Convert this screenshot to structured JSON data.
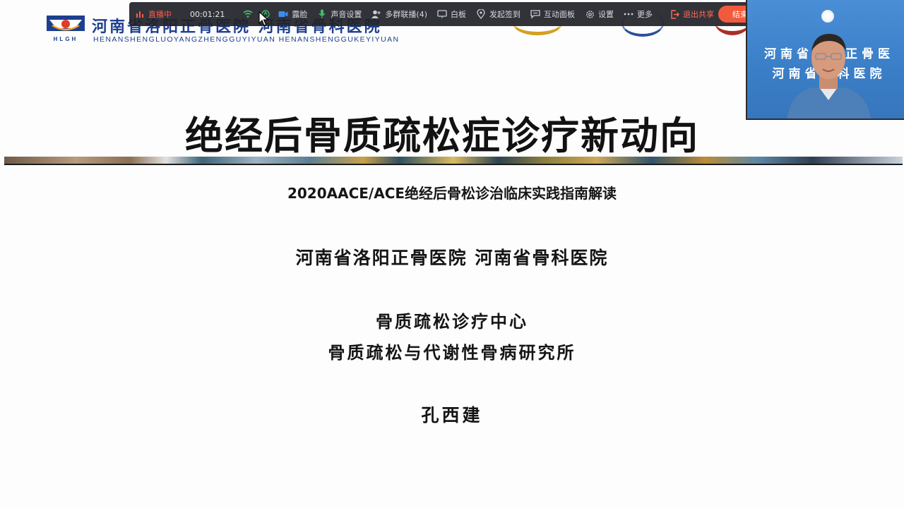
{
  "slide": {
    "logo": {
      "brand_letters": "HLGH",
      "name_cn": "河南省洛阳正骨医院 河南省骨科医院",
      "name_pinyin": "HENANSHENGLUOYANGZHENGGUYIYUAN   HENANSHENGGUKEYIYUAN"
    },
    "title": "绝经后骨质疏松症诊疗新动向",
    "subtitle": "2020AACE/ACE绝经后骨松诊治临床实践指南解读",
    "hospitals": "河南省洛阳正骨医院    河南省骨科医院",
    "center": "骨质疏松诊疗中心",
    "institute": "骨质疏松与代谢性骨病研究所",
    "author": "孔西建"
  },
  "toolbar": {
    "live_label": "直播中",
    "timer": "00:01:21",
    "beauty_label": "露脸",
    "audio_label": "声音设置",
    "multi_group_label": "多群联播(4)",
    "whiteboard_label": "白板",
    "checkin_label": "发起签到",
    "panel_label": "互动面板",
    "settings_label": "设置",
    "more_label": "更多",
    "exit_share_label": "退出共享",
    "end_label": "结束"
  },
  "video": {
    "bg_line_1": "河南省洛阳正骨医",
    "bg_line_2": "河南省骨科医院"
  },
  "colors": {
    "toolbar_bg": "#22242a",
    "live_red": "#ff5a4d",
    "end_button": "#f15a3c",
    "logo_blue": "#1e3f8f",
    "video_bg": "#3b7fc8"
  }
}
